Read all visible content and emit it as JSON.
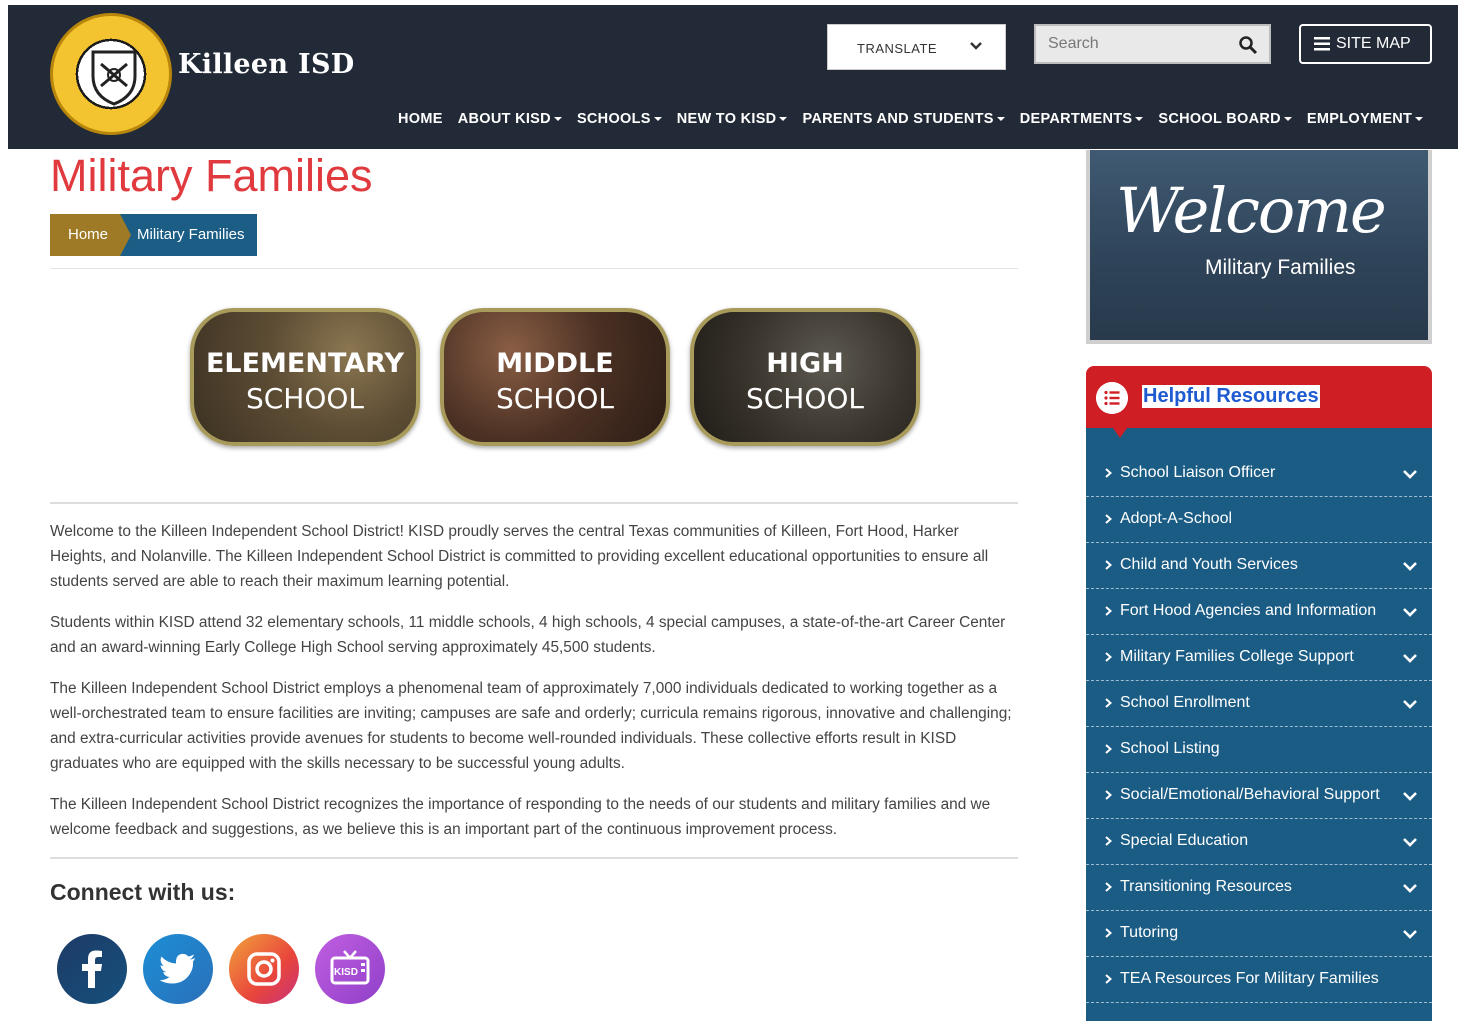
{
  "header": {
    "logo_text": "Killeen ISD",
    "translate_label": "TRANSLATE",
    "search_placeholder": "Search",
    "sitemap_label": "SITE MAP",
    "nav": [
      {
        "label": "HOME",
        "caret": false
      },
      {
        "label": "ABOUT KISD",
        "caret": true
      },
      {
        "label": "SCHOOLS",
        "caret": true
      },
      {
        "label": "NEW TO KISD",
        "caret": true
      },
      {
        "label": "PARENTS AND STUDENTS",
        "caret": true
      },
      {
        "label": "DEPARTMENTS",
        "caret": true
      },
      {
        "label": "SCHOOL BOARD",
        "caret": true
      },
      {
        "label": "EMPLOYMENT",
        "caret": true
      }
    ]
  },
  "page": {
    "title": "Military Families",
    "breadcrumb": {
      "home": "Home",
      "current": "Military Families"
    }
  },
  "school_buttons": [
    {
      "line1": "ELEMENTARY",
      "line2": "SCHOOL"
    },
    {
      "line1": "MIDDLE",
      "line2": "SCHOOL"
    },
    {
      "line1": "HIGH",
      "line2": "SCHOOL"
    }
  ],
  "content": {
    "paragraphs": [
      "Welcome to the Killeen Independent School District! KISD proudly serves the central Texas communities of Killeen, Fort Hood, Harker Heights, and Nolanville. The Killeen Independent School District is committed to providing excellent educational opportunities to ensure all students served are able to reach their maximum learning potential.",
      "Students within KISD attend 32 elementary schools, 11 middle schools, 4 high schools, 4 special campuses, a state-of-the-art Career Center and an award-winning Early College High School serving approximately 45,500 students.",
      "The Killeen Independent School District employs a phenomenal team of approximately 7,000 individuals dedicated to working together as a well-orchestrated team to ensure facilities are inviting; campuses are safe and orderly; curricula remains rigorous, innovative and challenging; and extra-curricular activities provide avenues for students to become well-rounded individuals. These collective efforts result in KISD graduates who are equipped with the skills necessary to be successful young adults.",
      "The Killeen Independent School District recognizes the importance of responding to the needs of our students and military families and we welcome feedback and suggestions, as we believe this is an important part of the continuous improvement process."
    ],
    "connect_heading": "Connect with us:",
    "social_tv_label": "KISD"
  },
  "sidebar": {
    "welcome_script": "Welcome",
    "welcome_sub": "Military Families",
    "resources_title": "Helpful Resources",
    "resources": [
      {
        "label": "School Liaison Officer",
        "expandable": true
      },
      {
        "label": "Adopt-A-School",
        "expandable": false
      },
      {
        "label": "Child and Youth Services",
        "expandable": true
      },
      {
        "label": "Fort Hood Agencies and Information",
        "expandable": true
      },
      {
        "label": "Military Families College Support",
        "expandable": true
      },
      {
        "label": "School Enrollment",
        "expandable": true
      },
      {
        "label": "School Listing",
        "expandable": false
      },
      {
        "label": "Social/Emotional/Behavioral Support",
        "expandable": true
      },
      {
        "label": "Special Education",
        "expandable": true
      },
      {
        "label": "Transitioning Resources",
        "expandable": true
      },
      {
        "label": "Tutoring",
        "expandable": true
      },
      {
        "label": "TEA Resources For Military Families",
        "expandable": false
      }
    ]
  },
  "colors": {
    "header_bg": "#232a37",
    "title_red": "#e03a3e",
    "breadcrumb_gold": "#9e7a26",
    "breadcrumb_blue": "#1b5d85",
    "resources_red": "#cf1f25",
    "resources_blue": "#1b5c84"
  }
}
